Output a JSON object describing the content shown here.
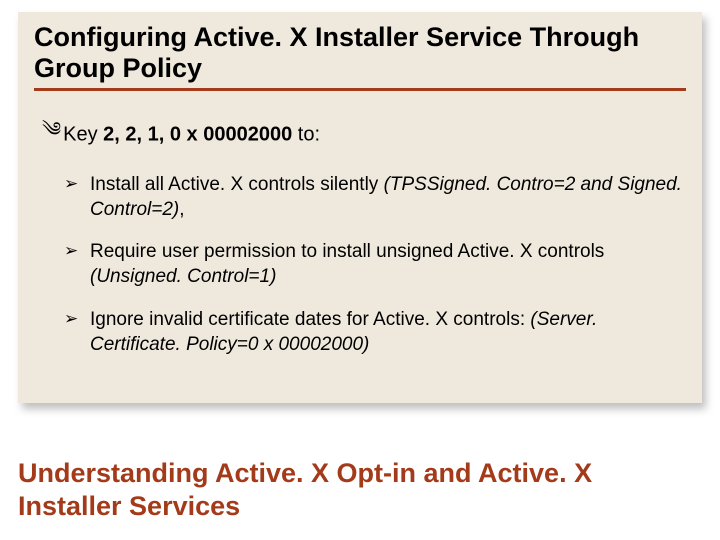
{
  "title": "Configuring Active. X Installer Service Through Group Policy",
  "keyLine": {
    "label": "Key ",
    "value": "2, 2, 1, 0 x 00002000",
    "suffix": " to:"
  },
  "bullets": [
    {
      "text": "Install all Active. X controls silently ",
      "italic": "(TPSSigned. Contro=2 and Signed. Control=2)",
      "trail": ","
    },
    {
      "text": "Require user permission to install unsigned Active. X controls ",
      "italic": "(Unsigned. Control=1)",
      "trail": ""
    },
    {
      "text": "Ignore invalid certificate dates for Active. X controls: ",
      "italic": "(Server. Certificate. Policy=0 x 00002000)",
      "trail": ""
    }
  ],
  "footer": "Understanding Active. X Opt-in and Active. X Installer Services"
}
